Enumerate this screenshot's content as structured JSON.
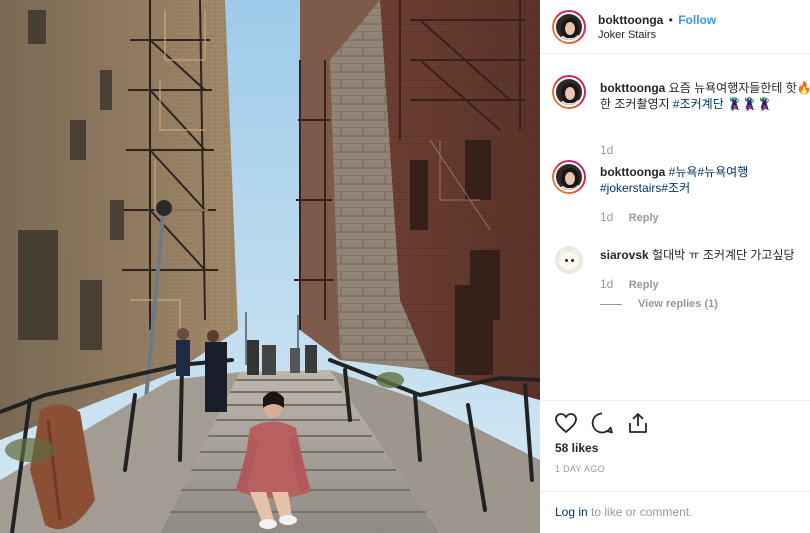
{
  "post": {
    "author": "bokttoonga",
    "follow_separator": "•",
    "follow_label": "Follow",
    "location": "Joker Stairs"
  },
  "comments": [
    {
      "username": "bokttoonga",
      "text": "요즘 뉴욕여행자들한테 핫🔥한 조커촬영지",
      "tags": "#조커계단",
      "trailing": "🦹🦹🦹",
      "time": "1d"
    },
    {
      "username": "bokttoonga",
      "tags_line1": "#뉴욕#뉴욕여행",
      "tags_line2": "#jokerstairs#조커",
      "time": "1d",
      "reply_label": "Reply"
    },
    {
      "username": "siarovsk",
      "text": "헐대박 ㅠ 조커계단 가고싶당",
      "time": "1d",
      "reply_label": "Reply",
      "view_replies": "View replies (1)"
    }
  ],
  "actions": {
    "like_icon": "heart-icon",
    "comment_icon": "comment-icon",
    "share_icon": "share-icon",
    "likes": "58 likes",
    "posted": "1 DAY AGO"
  },
  "footer": {
    "login_label": "Log in",
    "login_suffix": "to like or comment."
  },
  "colors": {
    "link": "#3897f0",
    "tag": "#003569",
    "muted": "#999999",
    "text": "#262626",
    "sky": "#9ecbea"
  }
}
